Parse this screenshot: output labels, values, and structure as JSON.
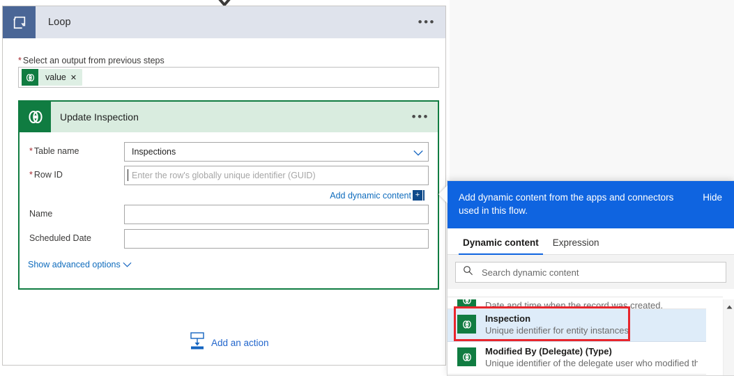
{
  "canvas": {
    "top_arrow_icon": "chevron-down-icon",
    "loop": {
      "icon": "loop-icon",
      "title": "Loop",
      "more_label": "…",
      "output_field": {
        "label": "Select an output from previous steps",
        "required": true,
        "token": {
          "icon": "dataverse-icon",
          "label": "value",
          "remove_label": "✕"
        }
      }
    },
    "action_card": {
      "icon": "dataverse-icon",
      "title": "Update Inspection",
      "more_label": "…",
      "fields": [
        {
          "label": "Table name",
          "required": true,
          "value": "Inspections",
          "placeholder": "",
          "type": "dropdown"
        },
        {
          "label": "Row ID",
          "required": true,
          "value": "",
          "placeholder": "Enter the row's globally unique identifier (GUID)",
          "type": "text"
        },
        {
          "label": "Name",
          "required": false,
          "value": "",
          "placeholder": "",
          "type": "text"
        },
        {
          "label": "Scheduled Date",
          "required": false,
          "value": "",
          "placeholder": "",
          "type": "text"
        }
      ],
      "add_dynamic_content_link": "Add dynamic content",
      "add_dynamic_content_plus": "+",
      "show_advanced_options": "Show advanced options"
    },
    "add_action": {
      "icon": "add-action-icon",
      "label": "Add an action"
    }
  },
  "dynamic_content_panel": {
    "banner": {
      "text": "Add dynamic content from the apps and connectors used in this flow.",
      "hide_label": "Hide"
    },
    "tabs": [
      {
        "label": "Dynamic content",
        "active": true
      },
      {
        "label": "Expression",
        "active": false
      }
    ],
    "search": {
      "icon": "search-icon",
      "placeholder": "Search dynamic content",
      "value": ""
    },
    "items": [
      {
        "icon": "dataverse-icon",
        "title": "",
        "description": "Date and time when the record was created.",
        "selected": false,
        "clipped": true
      },
      {
        "icon": "dataverse-icon",
        "title": "Inspection",
        "description": "Unique identifier for entity instances",
        "selected": true,
        "clipped": false
      },
      {
        "icon": "dataverse-icon",
        "title": "Modified By (Delegate) (Type)",
        "description": "Unique identifier of the delegate user who modified the r…",
        "selected": false,
        "clipped": false
      }
    ],
    "scroll_up_icon": "caret-up-icon"
  },
  "colors": {
    "loop_header": "#dfe3ec",
    "loop_icon_bg": "#4a6696",
    "dataverse_green": "#107c41",
    "action_header": "#d9ecdf",
    "banner_blue": "#0f64e0",
    "link_blue": "#0f6cbd",
    "highlight_red": "#e8262d",
    "selected_row": "#deecf9",
    "required_star": "#a4262c"
  }
}
